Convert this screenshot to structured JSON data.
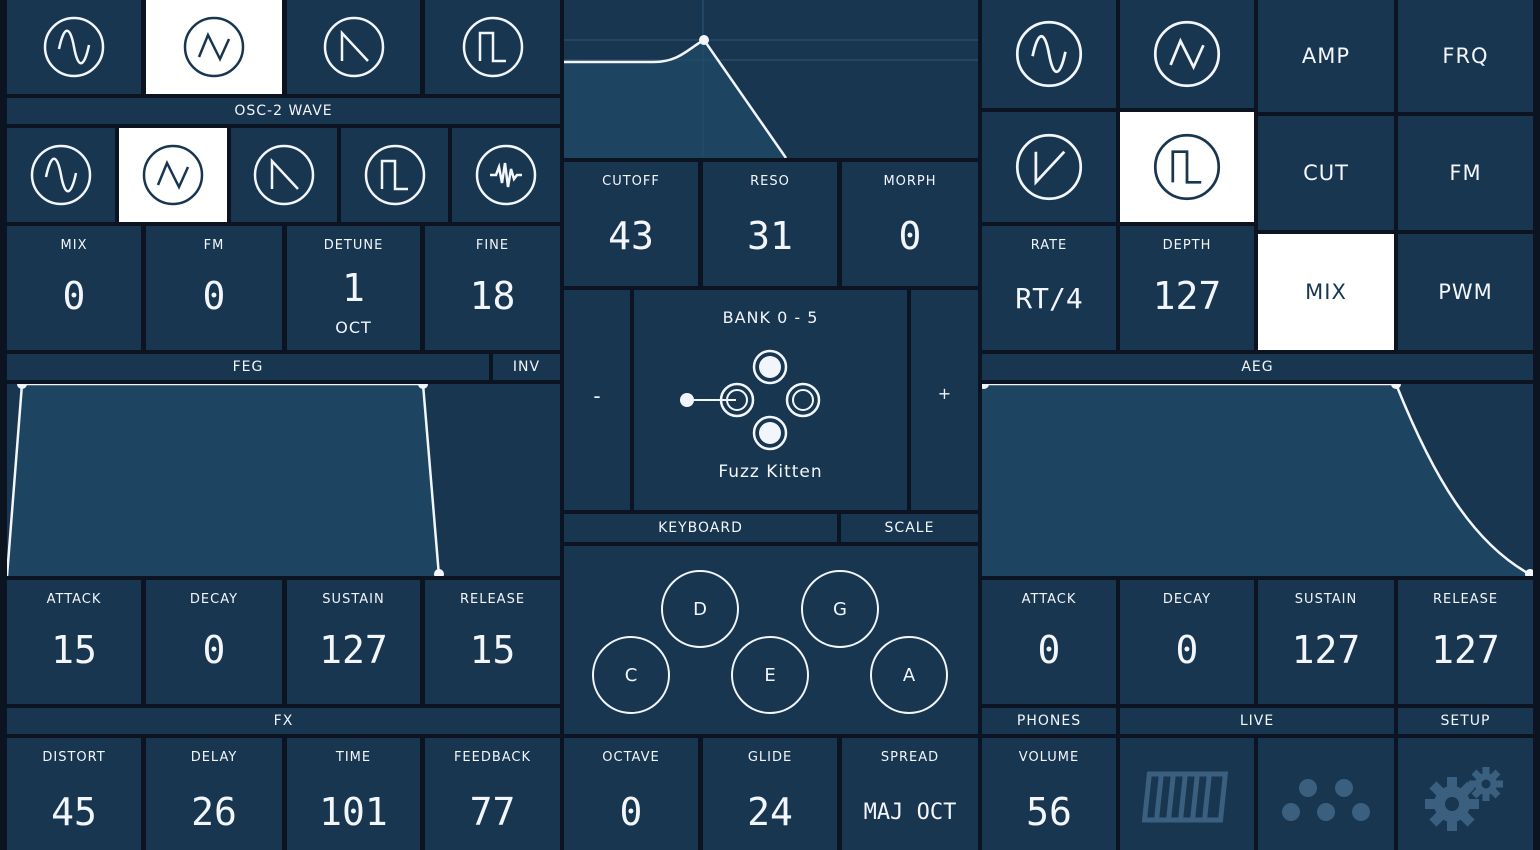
{
  "osc1": {
    "waves": [
      "sine-wave-icon",
      "triangle-wave-icon",
      "saw-wave-icon",
      "square-wave-icon"
    ],
    "selected": 1
  },
  "osc2": {
    "label": "OSC-2 WAVE",
    "waves": [
      "sine-wave-icon",
      "triangle-wave-icon",
      "saw-wave-icon",
      "square-wave-icon",
      "noise-wave-icon"
    ],
    "selected": 1
  },
  "osc_params": [
    {
      "label": "MIX",
      "value": "0"
    },
    {
      "label": "FM",
      "value": "0"
    },
    {
      "label": "DETUNE",
      "value": "1",
      "sub": "OCT"
    },
    {
      "label": "FINE",
      "value": "18"
    }
  ],
  "feg": {
    "label": "FEG",
    "inv": "INV"
  },
  "feg_params": [
    {
      "label": "ATTACK",
      "value": "15"
    },
    {
      "label": "DECAY",
      "value": "0"
    },
    {
      "label": "SUSTAIN",
      "value": "127"
    },
    {
      "label": "RELEASE",
      "value": "15"
    }
  ],
  "fx": {
    "label": "FX"
  },
  "fx_params": [
    {
      "label": "DISTORT",
      "value": "45"
    },
    {
      "label": "DELAY",
      "value": "26"
    },
    {
      "label": "TIME",
      "value": "101"
    },
    {
      "label": "FEEDBACK",
      "value": "77"
    }
  ],
  "filter": [
    {
      "label": "CUTOFF",
      "value": "43"
    },
    {
      "label": "RESO",
      "value": "31"
    },
    {
      "label": "MORPH",
      "value": "0"
    }
  ],
  "bank": {
    "title": "BANK 0 - 5",
    "name": "Fuzz Kitten",
    "prev": "-",
    "next": "+"
  },
  "tabs": {
    "keyboard": "KEYBOARD",
    "scale": "SCALE"
  },
  "notes": [
    "C",
    "D",
    "E",
    "G",
    "A"
  ],
  "play_params": [
    {
      "label": "OCTAVE",
      "value": "0"
    },
    {
      "label": "GLIDE",
      "value": "24"
    },
    {
      "label": "SPREAD",
      "value": "MAJ OCT"
    }
  ],
  "lfo": {
    "waves": [
      "sine-wave-icon",
      "triangle-wave-icon",
      "ramp-wave-icon",
      "square-wave-icon"
    ],
    "selected": 3,
    "targets": [
      "AMP",
      "FRQ",
      "CUT",
      "FM",
      "MIX",
      "PWM"
    ],
    "selected_target": "MIX",
    "rate": {
      "label": "RATE",
      "value": "RT/4"
    },
    "depth": {
      "label": "DEPTH",
      "value": "127"
    }
  },
  "aeg": {
    "label": "AEG"
  },
  "aeg_params": [
    {
      "label": "ATTACK",
      "value": "0"
    },
    {
      "label": "DECAY",
      "value": "0"
    },
    {
      "label": "SUSTAIN",
      "value": "127"
    },
    {
      "label": "RELEASE",
      "value": "127"
    }
  ],
  "bottom_tabs": {
    "phones": "PHONES",
    "live": "LIVE",
    "setup": "SETUP"
  },
  "volume": {
    "label": "VOLUME",
    "value": "56"
  },
  "icons": [
    "piano-icon",
    "dots-icon",
    "gears-icon"
  ],
  "colors": {
    "panel": "#183650",
    "background": "#0b1420",
    "selected": "#ffffff",
    "text": "#f2f6fb"
  }
}
